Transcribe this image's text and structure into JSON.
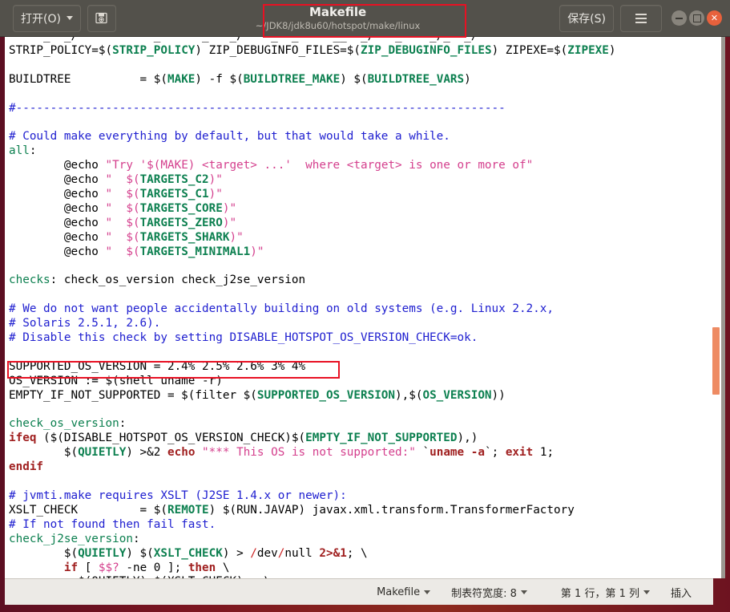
{
  "window": {
    "title": "Makefile",
    "subtitle": "~/JDK8/jdk8u60/hotspot/make/linux",
    "open_button": "打开(O)",
    "save_button": "保存(S)",
    "saveas_icon": "save-as-icon",
    "menu_icon": "hamburger-menu-icon",
    "minimize_icon": "minimize-icon",
    "maximize_icon": "maximize-icon",
    "close_icon": "close-icon",
    "accent_color": "#e8613c",
    "titlebar_color": "#53514b",
    "highlight_color": "#e81123"
  },
  "statusbar": {
    "language": "Makefile",
    "tab_width": "制表符宽度: 8",
    "cursor_position": "第 1 行，第 1 列",
    "insert_mode": "插入"
  },
  "scrollbar": {
    "thumb_color": "#ee8b63",
    "orientation": "vertical"
  },
  "editor": {
    "filename": "Makefile",
    "lines": [
      {
        "i": 0,
        "tokens": [
          {
            "t": "     _  _/           _      _   _/    _  _     __  _/   _    _/_  _/",
            "c": "c-plain"
          }
        ]
      },
      {
        "i": 1,
        "tokens": [
          {
            "t": "STRIP_POLICY=$(",
            "c": "c-plain"
          },
          {
            "t": "STRIP_POLICY",
            "c": "c-var"
          },
          {
            "t": ") ZIP_DEBUGINFO_FILES=$(",
            "c": "c-plain"
          },
          {
            "t": "ZIP_DEBUGINFO_FILES",
            "c": "c-var"
          },
          {
            "t": ") ZIPEXE=$(",
            "c": "c-plain"
          },
          {
            "t": "ZIPEXE",
            "c": "c-var"
          },
          {
            "t": ")",
            "c": "c-plain"
          }
        ]
      },
      {
        "i": 2,
        "tokens": [
          {
            "t": "",
            "c": "c-plain"
          }
        ]
      },
      {
        "i": 3,
        "tokens": [
          {
            "t": "BUILDTREE          = $(",
            "c": "c-plain"
          },
          {
            "t": "MAKE",
            "c": "c-var"
          },
          {
            "t": ") -f $(",
            "c": "c-plain"
          },
          {
            "t": "BUILDTREE_MAKE",
            "c": "c-var"
          },
          {
            "t": ") $(",
            "c": "c-plain"
          },
          {
            "t": "BUILDTREE_VARS",
            "c": "c-var"
          },
          {
            "t": ")",
            "c": "c-plain"
          }
        ]
      },
      {
        "i": 4,
        "tokens": [
          {
            "t": "",
            "c": "c-plain"
          }
        ]
      },
      {
        "i": 5,
        "tokens": [
          {
            "t": "#-----------------------------------------------------------------------",
            "c": "c-cmt"
          }
        ]
      },
      {
        "i": 6,
        "tokens": [
          {
            "t": "",
            "c": "c-plain"
          }
        ]
      },
      {
        "i": 7,
        "tokens": [
          {
            "t": "# Could make everything by default, but that would take a while.",
            "c": "c-cmt"
          }
        ]
      },
      {
        "i": 8,
        "tokens": [
          {
            "t": "all",
            "c": "c-tgt"
          },
          {
            "t": ":",
            "c": "c-plain"
          }
        ]
      },
      {
        "i": 9,
        "tokens": [
          {
            "t": "        @echo ",
            "c": "c-plain"
          },
          {
            "t": "\"Try '$(MAKE) <target> ...'  where <target> is one or more of\"",
            "c": "c-str"
          }
        ]
      },
      {
        "i": 10,
        "tokens": [
          {
            "t": "        @echo ",
            "c": "c-plain"
          },
          {
            "t": "\"  $(",
            "c": "c-str"
          },
          {
            "t": "TARGETS_C2",
            "c": "c-var"
          },
          {
            "t": ")\"",
            "c": "c-str"
          }
        ]
      },
      {
        "i": 11,
        "tokens": [
          {
            "t": "        @echo ",
            "c": "c-plain"
          },
          {
            "t": "\"  $(",
            "c": "c-str"
          },
          {
            "t": "TARGETS_C1",
            "c": "c-var"
          },
          {
            "t": ")\"",
            "c": "c-str"
          }
        ]
      },
      {
        "i": 12,
        "tokens": [
          {
            "t": "        @echo ",
            "c": "c-plain"
          },
          {
            "t": "\"  $(",
            "c": "c-str"
          },
          {
            "t": "TARGETS_CORE",
            "c": "c-var"
          },
          {
            "t": ")\"",
            "c": "c-str"
          }
        ]
      },
      {
        "i": 13,
        "tokens": [
          {
            "t": "        @echo ",
            "c": "c-plain"
          },
          {
            "t": "\"  $(",
            "c": "c-str"
          },
          {
            "t": "TARGETS_ZERO",
            "c": "c-var"
          },
          {
            "t": ")\"",
            "c": "c-str"
          }
        ]
      },
      {
        "i": 14,
        "tokens": [
          {
            "t": "        @echo ",
            "c": "c-plain"
          },
          {
            "t": "\"  $(",
            "c": "c-str"
          },
          {
            "t": "TARGETS_SHARK",
            "c": "c-var"
          },
          {
            "t": ")\"",
            "c": "c-str"
          }
        ]
      },
      {
        "i": 15,
        "tokens": [
          {
            "t": "        @echo ",
            "c": "c-plain"
          },
          {
            "t": "\"  $(",
            "c": "c-str"
          },
          {
            "t": "TARGETS_MINIMAL1",
            "c": "c-var"
          },
          {
            "t": ")\"",
            "c": "c-str"
          }
        ]
      },
      {
        "i": 16,
        "tokens": [
          {
            "t": "",
            "c": "c-plain"
          }
        ]
      },
      {
        "i": 17,
        "tokens": [
          {
            "t": "checks",
            "c": "c-tgt"
          },
          {
            "t": ": check_os_version check_j2se_version",
            "c": "c-plain"
          }
        ]
      },
      {
        "i": 18,
        "tokens": [
          {
            "t": "",
            "c": "c-plain"
          }
        ]
      },
      {
        "i": 19,
        "tokens": [
          {
            "t": "# We do not want people accidentally building on old systems (e.g. Linux 2.2.x,",
            "c": "c-cmt"
          }
        ]
      },
      {
        "i": 20,
        "tokens": [
          {
            "t": "# Solaris 2.5.1, 2.6).",
            "c": "c-cmt"
          }
        ]
      },
      {
        "i": 21,
        "tokens": [
          {
            "t": "# Disable this check by setting DISABLE_HOTSPOT_OS_VERSION_CHECK=ok.",
            "c": "c-cmt"
          }
        ]
      },
      {
        "i": 22,
        "tokens": [
          {
            "t": "",
            "c": "c-plain"
          }
        ]
      },
      {
        "i": 23,
        "tokens": [
          {
            "t": "SUPPORTED_OS_VERSION = 2.4% 2.5% 2.6% 3% 4%",
            "c": "c-plain"
          }
        ]
      },
      {
        "i": 24,
        "tokens": [
          {
            "t": "OS_VERSION := $(shell uname -r)",
            "c": "c-plain"
          }
        ]
      },
      {
        "i": 25,
        "tokens": [
          {
            "t": "EMPTY_IF_NOT_SUPPORTED = $(filter $(",
            "c": "c-plain"
          },
          {
            "t": "SUPPORTED_OS_VERSION",
            "c": "c-var"
          },
          {
            "t": "),$(",
            "c": "c-plain"
          },
          {
            "t": "OS_VERSION",
            "c": "c-var"
          },
          {
            "t": "))",
            "c": "c-plain"
          }
        ]
      },
      {
        "i": 26,
        "tokens": [
          {
            "t": "",
            "c": "c-plain"
          }
        ]
      },
      {
        "i": 27,
        "tokens": [
          {
            "t": "check_os_version",
            "c": "c-tgt"
          },
          {
            "t": ":",
            "c": "c-plain"
          }
        ]
      },
      {
        "i": 28,
        "tokens": [
          {
            "t": "ifeq",
            "c": "c-kw"
          },
          {
            "t": " ($(DISABLE_HOTSPOT_OS_VERSION_CHECK)$(",
            "c": "c-plain"
          },
          {
            "t": "EMPTY_IF_NOT_SUPPORTED",
            "c": "c-var"
          },
          {
            "t": "),)",
            "c": "c-plain"
          }
        ]
      },
      {
        "i": 29,
        "tokens": [
          {
            "t": "        $(",
            "c": "c-plain"
          },
          {
            "t": "QUIETLY",
            "c": "c-var"
          },
          {
            "t": ") >&2 ",
            "c": "c-plain"
          },
          {
            "t": "echo",
            "c": "c-kw"
          },
          {
            "t": " ",
            "c": "c-plain"
          },
          {
            "t": "\"*** This OS is not supported:\"",
            "c": "c-str"
          },
          {
            "t": " `",
            "c": "c-plain"
          },
          {
            "t": "uname -a",
            "c": "c-kw"
          },
          {
            "t": "`; ",
            "c": "c-plain"
          },
          {
            "t": "exit",
            "c": "c-kw"
          },
          {
            "t": " 1;",
            "c": "c-plain"
          }
        ]
      },
      {
        "i": 30,
        "tokens": [
          {
            "t": "endif",
            "c": "c-kw"
          }
        ]
      },
      {
        "i": 31,
        "tokens": [
          {
            "t": "",
            "c": "c-plain"
          }
        ]
      },
      {
        "i": 32,
        "tokens": [
          {
            "t": "# jvmti.make requires XSLT (J2SE 1.4.x or newer):",
            "c": "c-cmt"
          }
        ]
      },
      {
        "i": 33,
        "tokens": [
          {
            "t": "XSLT_CHECK         = $(",
            "c": "c-plain"
          },
          {
            "t": "REMOTE",
            "c": "c-var"
          },
          {
            "t": ") $(RUN.JAVAP) javax.xml.transform.TransformerFactory",
            "c": "c-plain"
          }
        ]
      },
      {
        "i": 34,
        "tokens": [
          {
            "t": "# If not found then fail fast.",
            "c": "c-cmt"
          }
        ]
      },
      {
        "i": 35,
        "tokens": [
          {
            "t": "check_j2se_version",
            "c": "c-tgt"
          },
          {
            "t": ":",
            "c": "c-plain"
          }
        ]
      },
      {
        "i": 36,
        "tokens": [
          {
            "t": "        $(",
            "c": "c-plain"
          },
          {
            "t": "QUIETLY",
            "c": "c-var"
          },
          {
            "t": ") $(",
            "c": "c-plain"
          },
          {
            "t": "XSLT_CHECK",
            "c": "c-var"
          },
          {
            "t": ") > ",
            "c": "c-plain"
          },
          {
            "t": "/",
            "c": "c-red"
          },
          {
            "t": "dev",
            "c": "c-plain"
          },
          {
            "t": "/",
            "c": "c-red"
          },
          {
            "t": "null ",
            "c": "c-plain"
          },
          {
            "t": "2>&1",
            "c": "c-kw"
          },
          {
            "t": "; \\",
            "c": "c-plain"
          }
        ]
      },
      {
        "i": 37,
        "tokens": [
          {
            "t": "        ",
            "c": "c-plain"
          },
          {
            "t": "if",
            "c": "c-kw"
          },
          {
            "t": " [ ",
            "c": "c-plain"
          },
          {
            "t": "$$?",
            "c": "c-str"
          },
          {
            "t": " -ne 0 ]; ",
            "c": "c-plain"
          },
          {
            "t": "then",
            "c": "c-kw"
          },
          {
            "t": " \\",
            "c": "c-plain"
          }
        ]
      },
      {
        "i": 38,
        "tokens": [
          {
            "t": "          $(QUIETLY) $(XSLT_CHECK) ; \\",
            "c": "c-plain"
          }
        ]
      }
    ]
  }
}
